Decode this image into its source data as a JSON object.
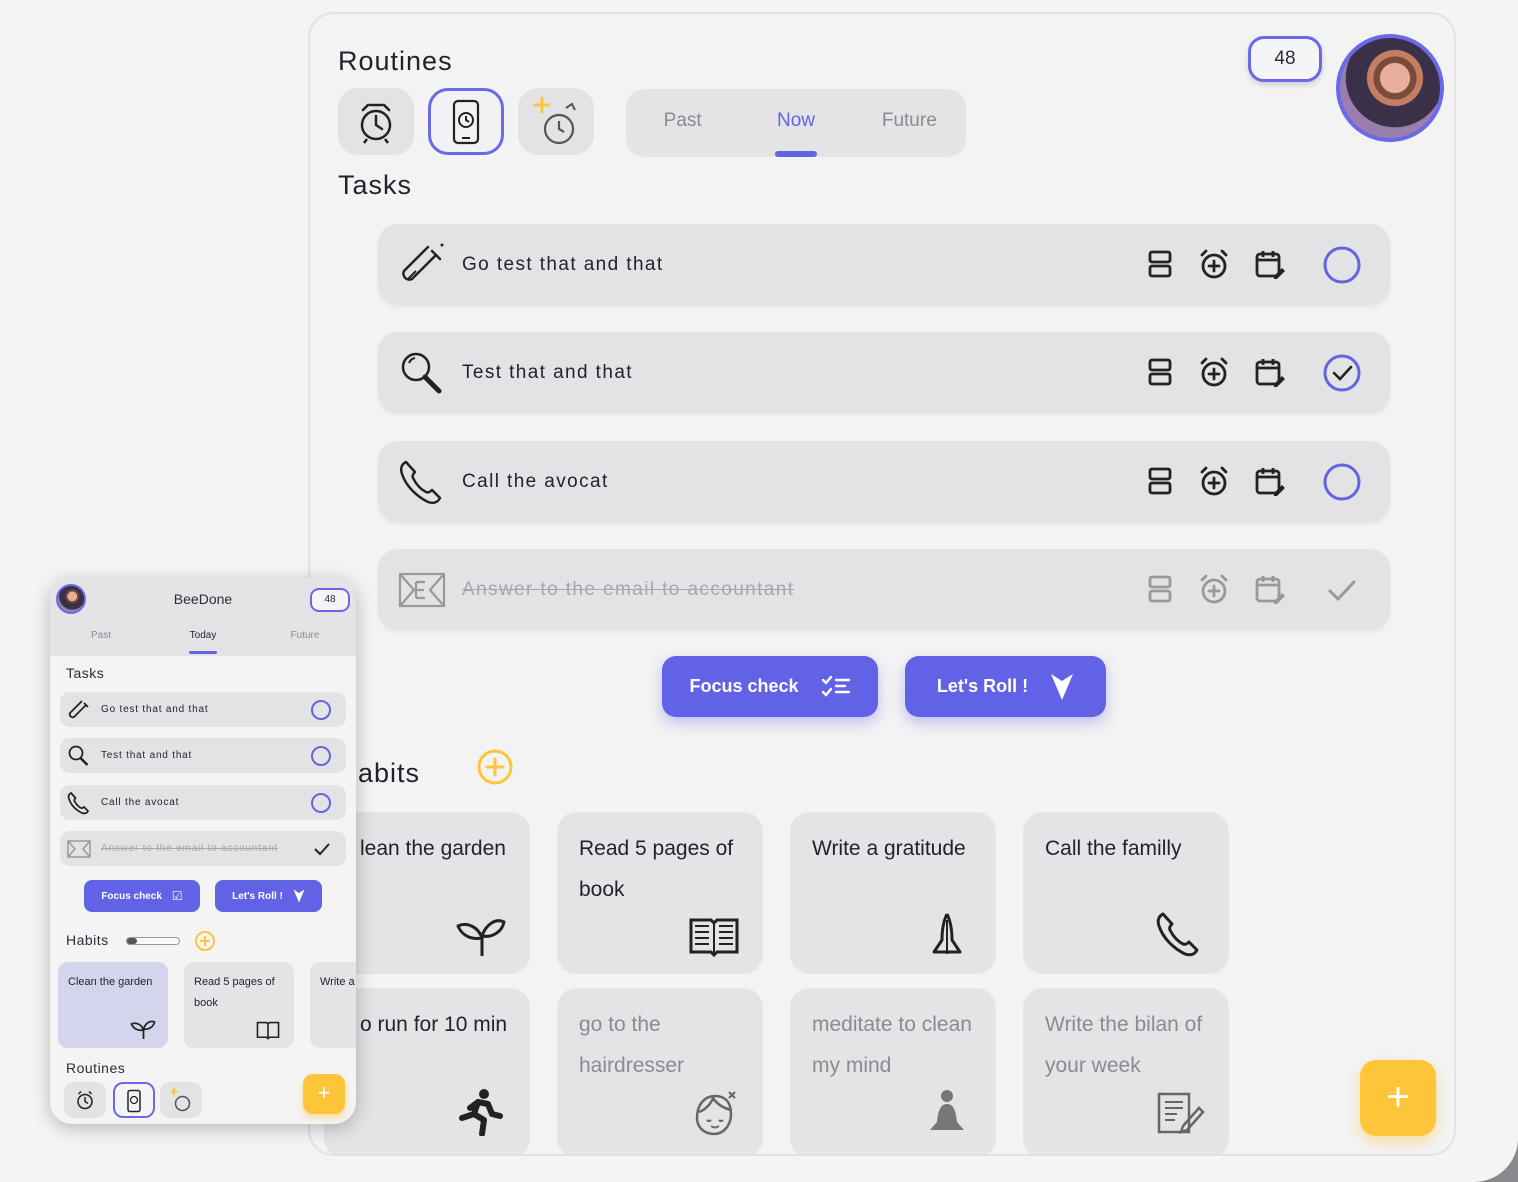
{
  "routines": {
    "title": "Routines",
    "buttons": [
      {
        "icon": "alarm-clock-icon"
      },
      {
        "icon": "phone-clock-icon",
        "active": true
      },
      {
        "icon": "sparkle-timer-icon"
      }
    ]
  },
  "tabs": {
    "past": "Past",
    "now": "Now",
    "future": "Future"
  },
  "badge": "48",
  "tasks_title": "Tasks",
  "tasks": [
    {
      "label": "Go test that and that",
      "icon": "test-tube-icon",
      "done": false
    },
    {
      "label": "Test that and that",
      "icon": "magnifier-icon",
      "done": true
    },
    {
      "label": "Call the avocat",
      "icon": "phone-icon",
      "done": false
    },
    {
      "label": "Answer to the email to accountant",
      "icon": "email-icon",
      "done": true
    }
  ],
  "buttons": {
    "focus": "Focus check",
    "roll": "Let's Roll !"
  },
  "habits": {
    "title": "abits",
    "items": [
      {
        "label": "lean the garden"
      },
      {
        "label": "Read 5 pages of book"
      },
      {
        "label": "Write a gratitude"
      },
      {
        "label": "Call the familly"
      },
      {
        "label": "o run for 10 min"
      },
      {
        "label": "go to the hairdresser"
      },
      {
        "label": "meditate to clean my mind"
      },
      {
        "label": "Write the bilan of your week"
      }
    ]
  },
  "fab": "+",
  "mini": {
    "app_title": "BeeDone",
    "badge": "48",
    "tabs": {
      "past": "Past",
      "today": "Today",
      "future": "Future"
    },
    "tasks_title": "Tasks",
    "tasks": [
      "Go test that and that",
      "Test that and that",
      "Call the avocat",
      "Answer to the email to accountant"
    ],
    "focus": "Focus check",
    "roll": "Let's Roll !",
    "habits_title": "Habits",
    "habits": [
      "Clean the garden",
      "Read 5 pages of book",
      "Write a"
    ],
    "routines_title": "Routines",
    "fab": "+"
  },
  "colors": {
    "accent": "#6464e0",
    "fab": "#fdc53a",
    "card": "#e3e3e6"
  }
}
